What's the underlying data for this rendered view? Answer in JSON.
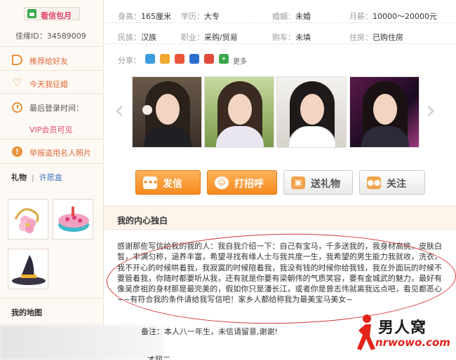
{
  "sidebar": {
    "vip_label": "看信包月",
    "user_id": "佳缘ID：34589009",
    "links": [
      {
        "label": "推荐给好友",
        "icon": "megaphone-icon"
      },
      {
        "label": "今天我征婚",
        "icon": "heart-icon"
      },
      {
        "label": "举报盗用名人照片",
        "icon": "alert-icon"
      }
    ],
    "login": {
      "label": "最后登录时间：",
      "value": "VIP会员可见",
      "icon": "clock-icon"
    },
    "gift_tabs": {
      "gift": "礼物",
      "separator": "|",
      "wish": "许愿盒"
    },
    "gifts": [
      "flower-gift",
      "cake-gift",
      "witch-hat-gift"
    ],
    "my_map": "我的地图"
  },
  "profile": {
    "rows": [
      [
        {
          "label": "身高：",
          "value": "165厘米"
        },
        {
          "label": "学历：",
          "value": "大专"
        },
        {
          "label": "婚姻：",
          "value": "未婚"
        },
        {
          "label": "月薪：",
          "value": "10000～20000元"
        }
      ],
      [
        {
          "label": "民族：",
          "value": "汉族"
        },
        {
          "label": "职业：",
          "value": "采购/贸易"
        },
        {
          "label": "购车：",
          "value": "未填"
        },
        {
          "label": "住房：",
          "value": "已购住房"
        }
      ]
    ],
    "share_label": "分享：",
    "share_more": "更多",
    "share_colors": [
      "#3d9be0",
      "#f0a830",
      "#e8553a",
      "#2a6fd0",
      "#e04a3a",
      "#3aa84a"
    ]
  },
  "gallery": {
    "prev_arrow": "‹",
    "next_arrow": "›"
  },
  "buttons": {
    "message": "发信",
    "greet": "打招呼",
    "gift": "送礼物",
    "follow": "关注"
  },
  "monologue": {
    "title": "我的内心独白",
    "text": "感谢那些写信给我的我的人：我自我介绍一下：自己有宝马，千多送我的，我身材高挑，皮肤白皙，丰满匀称，涵养丰富，希望寻找有缘人士与我共度一生，我希望的男生能力我就收，洗衣，我不开心的时候哄着我，我寂寞的时候陪着我，我没有钱的时候你给我钱，我在外面玩的时候不要管着我，你随时都要听从我，还有就是你要有梁朝伟的气质笑容，要有金城武的魅力，最好有像吴彦祖的身材那是最完美的，假如你只是潘长江，或者你是曾志伟就离我远点吧，看见都恶心~~有符合我的条件请给我写信吧！家乡人都给称我为最美宝马美女~",
    "remark": "备注：本人八一年生，未信请留意,谢谢!",
    "cut_text": "才屈二"
  },
  "watermark": {
    "title": "男人窝",
    "url": "nrwowo.com"
  }
}
